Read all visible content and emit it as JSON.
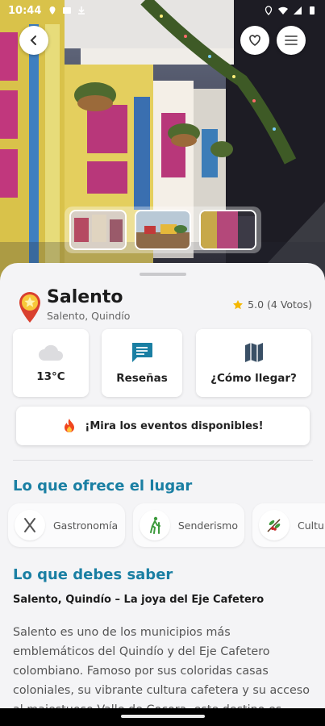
{
  "status_bar": {
    "time": "10:44"
  },
  "place": {
    "name": "Salento",
    "location": "Salento, Quindío",
    "rating": "5.0 (4 Votos)"
  },
  "cards": {
    "weather": "13°C",
    "reviews": "Reseñas",
    "directions": "¿Cómo llegar?"
  },
  "events_button": "¡Mira los eventos disponibles!",
  "offers": {
    "title": "Lo que ofrece el lugar",
    "items": [
      {
        "label": "Gastronomía",
        "icon": "cutlery-icon"
      },
      {
        "label": "Senderismo",
        "icon": "hiking-icon"
      },
      {
        "label": "Cultu",
        "icon": "coffee-branch-icon"
      }
    ]
  },
  "info": {
    "title": "Lo que debes saber",
    "subtitle": "Salento, Quindío – La joya del Eje Cafetero",
    "description": "Salento es uno de los municipios más emblemáticos del Quindío y del Eje Cafetero colombiano. Famoso por sus coloridas casas coloniales, su vibrante cultura cafetera y su acceso al majestuoso Valle de Cocora, este destino es ideal para quienes buscan"
  },
  "colors": {
    "accent": "#1a7fa3",
    "star": "#f5b800",
    "sheet": "#f4f4f6"
  }
}
